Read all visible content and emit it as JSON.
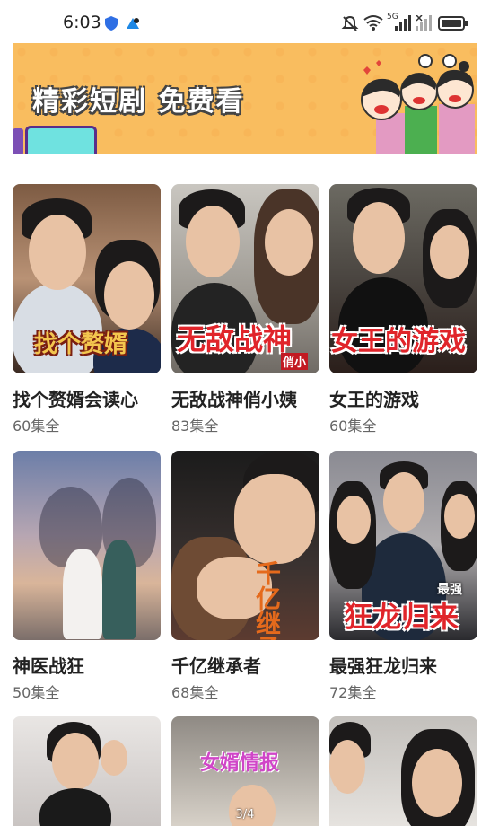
{
  "status_bar": {
    "time": "6:03",
    "signal_5g": "5G"
  },
  "banner": {
    "title": "精彩短剧 免费看"
  },
  "dramas": [
    {
      "title": "找个赘婿会读心",
      "episodes": "60集全",
      "cover_text": "找个赘婿"
    },
    {
      "title": "无敌战神俏小姨",
      "episodes": "83集全",
      "cover_text": "无敌战神",
      "cover_sub": "俏小"
    },
    {
      "title": "女王的游戏",
      "episodes": "60集全",
      "cover_text": "女王的游戏"
    },
    {
      "title": "神医战狂",
      "episodes": "50集全"
    },
    {
      "title": "千亿继承者",
      "episodes": "68集全",
      "cover_text": "千亿继承"
    },
    {
      "title": "最强狂龙归来",
      "episodes": "72集全",
      "cover_text": "狂龙归来",
      "cover_sub": "最强"
    },
    {
      "cover_text": "女婿情报"
    }
  ],
  "page_indicator": "3/4"
}
